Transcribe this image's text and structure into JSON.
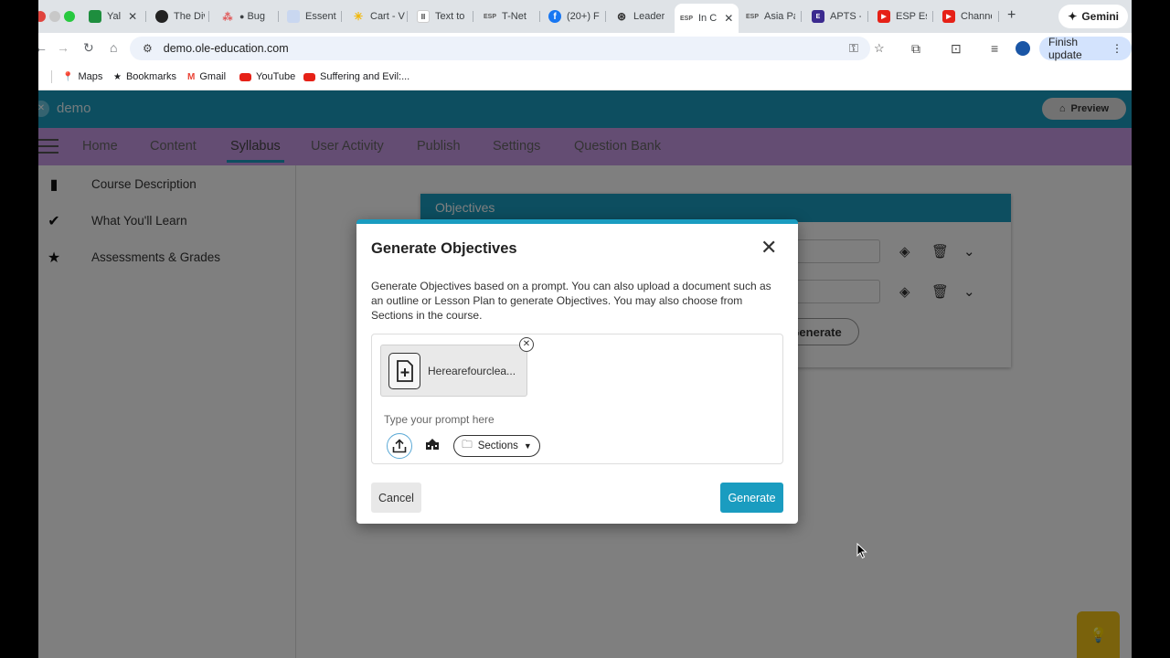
{
  "browser": {
    "tabs": [
      {
        "title": "Yal",
        "favicon_color": "#1e8e3e"
      },
      {
        "title": "The Div",
        "favicon_color": "#222222"
      },
      {
        "title": "Bug",
        "favicon_color": "#e05a5a"
      },
      {
        "title": "Essenti",
        "favicon_color": "#c9d7f0"
      },
      {
        "title": "Cart - V",
        "favicon_color": "#f2b705"
      },
      {
        "title": "Text to",
        "favicon_color": "#333333"
      },
      {
        "title": "T-Net",
        "favicon_color": "#555555"
      },
      {
        "title": "(20+) F",
        "favicon_color": "#1877f2"
      },
      {
        "title": "Leader",
        "favicon_color": "#333333"
      },
      {
        "title": "In C",
        "favicon_color": "#555555"
      },
      {
        "title": "Asia Pa",
        "favicon_color": "#555555"
      },
      {
        "title": "APTS -",
        "favicon_color": "#3b2a8f"
      },
      {
        "title": "ESP Es",
        "favicon_color": "#e62117"
      },
      {
        "title": "Channe",
        "favicon_color": "#e62117"
      }
    ],
    "gemini_label": "Gemini",
    "url": "demo.ole-education.com",
    "finish_update_label": "Finish update",
    "bookmarks": [
      {
        "label": "Maps"
      },
      {
        "label": "Bookmarks"
      },
      {
        "label": "Gmail"
      },
      {
        "label": "YouTube"
      },
      {
        "label": "Suffering and Evil:..."
      }
    ]
  },
  "app": {
    "course_name": "demo",
    "preview_label": "Preview",
    "nav": [
      "Home",
      "Content",
      "Syllabus",
      "User Activity",
      "Publish",
      "Settings",
      "Question Bank"
    ],
    "active_nav": "Syllabus",
    "sidebar": [
      "Course Description",
      "What You'll Learn",
      "Assessments & Grades"
    ],
    "objectives_header": "Objectives",
    "bg_generate_label": "Generate"
  },
  "modal": {
    "title": "Generate Objectives",
    "description": "Generate Objectives based on a prompt. You can also upload a document such as an outline or Lesson Plan to generate Objectives. You may also choose from Sections in the course.",
    "attachment_name": "Herearefourclea...",
    "prompt_placeholder": "Type your prompt here",
    "prompt_value": "",
    "sections_label": "Sections",
    "cancel_label": "Cancel",
    "generate_label": "Generate"
  },
  "colors": {
    "accent": "#1a9cc0",
    "nav_bar": "#c89be6"
  }
}
